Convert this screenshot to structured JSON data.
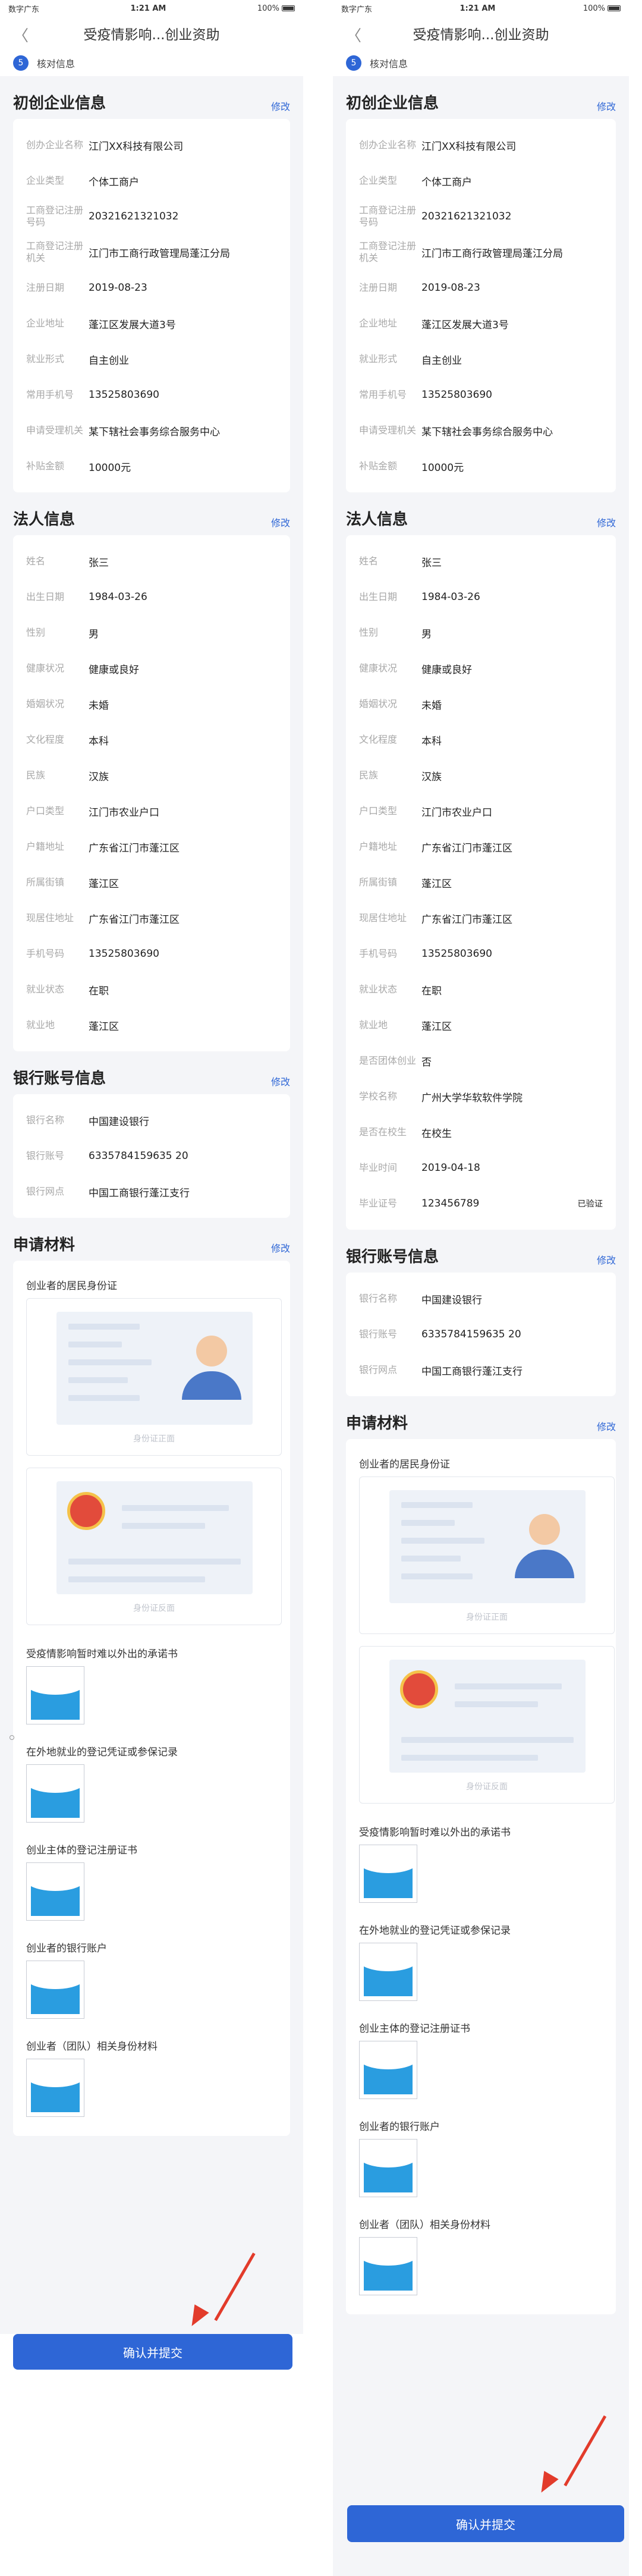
{
  "status": {
    "carrier": "数字广东",
    "time": "1:21 AM",
    "battery": "100%"
  },
  "nav": {
    "back": "〈",
    "title": "受疫情影响...创业资助"
  },
  "step": {
    "num": "5",
    "label": "核对信息"
  },
  "edit_label": "修改",
  "sections": {
    "company": "初创企业信息",
    "legal": "法人信息",
    "bank": "银行账号信息",
    "materials": "申请材料"
  },
  "company_rows": [
    {
      "l": "创办企业名称",
      "v": "江门XX科技有限公司"
    },
    {
      "l": "企业类型",
      "v": "个体工商户"
    },
    {
      "l": "工商登记注册号码",
      "v": "20321621321032"
    },
    {
      "l": "工商登记注册机关",
      "v": "江门市工商行政管理局蓬江分局"
    },
    {
      "l": "注册日期",
      "v": "2019-08-23"
    },
    {
      "l": "企业地址",
      "v": "蓬江区发展大道3号"
    },
    {
      "l": "就业形式",
      "v": "自主创业"
    },
    {
      "l": "常用手机号",
      "v": "13525803690"
    },
    {
      "l": "申请受理机关",
      "v": "某下辖社会事务综合服务中心"
    },
    {
      "l": "补贴金额",
      "v": "10000元"
    }
  ],
  "legal_rows_left": [
    {
      "l": "姓名",
      "v": "张三"
    },
    {
      "l": "出生日期",
      "v": "1984-03-26"
    },
    {
      "l": "性别",
      "v": "男"
    },
    {
      "l": "健康状况",
      "v": "健康或良好"
    },
    {
      "l": "婚姻状况",
      "v": "未婚"
    },
    {
      "l": "文化程度",
      "v": "本科"
    },
    {
      "l": "民族",
      "v": "汉族"
    },
    {
      "l": "户口类型",
      "v": "江门市农业户口"
    },
    {
      "l": "户籍地址",
      "v": "广东省江门市蓬江区"
    },
    {
      "l": "所属街镇",
      "v": "蓬江区"
    },
    {
      "l": "现居住地址",
      "v": "广东省江门市蓬江区"
    },
    {
      "l": "手机号码",
      "v": "13525803690"
    },
    {
      "l": "就业状态",
      "v": "在职"
    },
    {
      "l": "就业地",
      "v": "蓬江区"
    }
  ],
  "legal_rows_right_extra": [
    {
      "l": "是否团体创业",
      "v": "否"
    },
    {
      "l": "学校名称",
      "v": "广州大学华软软件学院"
    },
    {
      "l": "是否在校生",
      "v": "在校生"
    },
    {
      "l": "毕业时间",
      "v": "2019-04-18"
    },
    {
      "l": "毕业证号",
      "v": "123456789",
      "note": "已验证"
    }
  ],
  "bank_rows": [
    {
      "l": "银行名称",
      "v": "中国建设银行"
    },
    {
      "l": "银行账号",
      "v": "6335784159635 20"
    },
    {
      "l": "银行网点",
      "v": "中国工商银行蓬江支行"
    }
  ],
  "materials": {
    "id_title": "创业者的居民身份证",
    "id_front": "身份证正面",
    "id_back": "身份证反面",
    "items": [
      "受疫情影响暂时难以外出的承诺书",
      "在外地就业的登记凭证或参保记录",
      "创业主体的登记注册证书",
      "创业者的银行账户",
      "创业者（团队）相关身份材料"
    ]
  },
  "submit": "确认并提交",
  "colors": {
    "accent": "#2e66d6",
    "arrow": "#e23b2b",
    "page_bg": "#f4f5f8"
  }
}
